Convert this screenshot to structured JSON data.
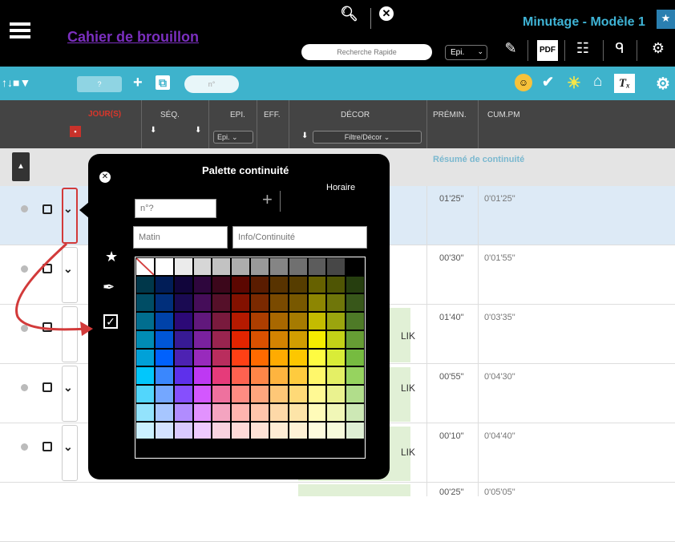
{
  "app": {
    "title": "Cahier de brouillon",
    "modele": "Minutage - Modèle 1",
    "search_placeholder": "Recherche Rapide",
    "epi_select": "Epi."
  },
  "toolbar2": {
    "small_box": "?",
    "pill": "n°"
  },
  "table": {
    "headers": {
      "jours": "JOUR(S)",
      "seq": "SÉQ.",
      "epi": "EPI.",
      "epi_sel": "Epi.",
      "eff": "EFF.",
      "decor": "DÉCOR",
      "decor_sel": "Filtre/Décor",
      "premin": "PRÉMIN.",
      "cumpm": "CUM.PM"
    },
    "section": "Résumé de continuité",
    "rows": [
      {
        "premin": "01'25\"",
        "cum": "0'01'25\"",
        "lik": ""
      },
      {
        "premin": "00'30\"",
        "cum": "0'01'55\"",
        "lik": ""
      },
      {
        "premin": "01'40\"",
        "cum": "0'03'35\"",
        "lik": "LIK"
      },
      {
        "premin": "00'55\"",
        "cum": "0'04'30\"",
        "lik": "LIK"
      },
      {
        "premin": "00'10\"",
        "cum": "0'04'40\"",
        "lik": "LIK"
      },
      {
        "premin": "00'25\"",
        "cum": "0'05'05\"",
        "lik": ""
      }
    ]
  },
  "palette": {
    "title": "Palette continuité",
    "horaire": "Horaire",
    "num_placeholder": "n°?",
    "matin_placeholder": "Matin",
    "info_placeholder": "Info/Continuité",
    "colors": [
      [
        "#ffffff",
        "#ffffff",
        "#ebebeb",
        "#d6d6d6",
        "#c2c2c2",
        "#adadad",
        "#999999",
        "#858585",
        "#707070",
        "#5c5c5c",
        "#474747",
        "#000000"
      ],
      [
        "#00374a",
        "#011d57",
        "#11053b",
        "#2e063d",
        "#3c071b",
        "#5c0701",
        "#5a1c00",
        "#583300",
        "#563d00",
        "#666100",
        "#4f5504",
        "#263e0f"
      ],
      [
        "#004d65",
        "#012f7b",
        "#1a0a52",
        "#450d59",
        "#551029",
        "#831100",
        "#7b2900",
        "#7a4a00",
        "#785800",
        "#8d8602",
        "#6f760a",
        "#38571a"
      ],
      [
        "#016e8f",
        "#0042a9",
        "#2c0977",
        "#61187c",
        "#791a3d",
        "#b51a00",
        "#ad3e00",
        "#a96800",
        "#a67b01",
        "#c4bc00",
        "#9ba50e",
        "#4e7a27"
      ],
      [
        "#008cb4",
        "#0056d6",
        "#371a94",
        "#7a219e",
        "#99244f",
        "#e22400",
        "#da5100",
        "#d38301",
        "#d19d01",
        "#f5ec00",
        "#c3d117",
        "#669d34"
      ],
      [
        "#00a1d8",
        "#0061fd",
        "#4d22b2",
        "#982abc",
        "#b92d5d",
        "#ff4015",
        "#ff6a00",
        "#ffab01",
        "#fdc700",
        "#fefb41",
        "#d9ec37",
        "#76bb40"
      ],
      [
        "#01c7fc",
        "#3a87fd",
        "#5e30eb",
        "#be38f3",
        "#e63b7a",
        "#fe6250",
        "#fe8648",
        "#feb43f",
        "#fecb3e",
        "#fff76b",
        "#e4ef65",
        "#96d35f"
      ],
      [
        "#52d6fc",
        "#74a7ff",
        "#864ffd",
        "#d357fe",
        "#ee719e",
        "#ff8c82",
        "#fea57d",
        "#fec777",
        "#fed977",
        "#fff994",
        "#eaf28f",
        "#b1dd8b"
      ],
      [
        "#93e3fc",
        "#a7c6ff",
        "#b18cfe",
        "#e292fe",
        "#f4a4c0",
        "#ffb5af",
        "#ffc5ab",
        "#fed9a8",
        "#fde4a8",
        "#fffbb9",
        "#f1f7b7",
        "#cde8b5"
      ],
      [
        "#cbf0ff",
        "#d3e2ff",
        "#d9c9fe",
        "#efcaff",
        "#f9d3e0",
        "#ffdad8",
        "#ffe2d6",
        "#feecd4",
        "#fef1d5",
        "#fdfbdd",
        "#f6fadb",
        "#deeed4"
      ]
    ]
  }
}
